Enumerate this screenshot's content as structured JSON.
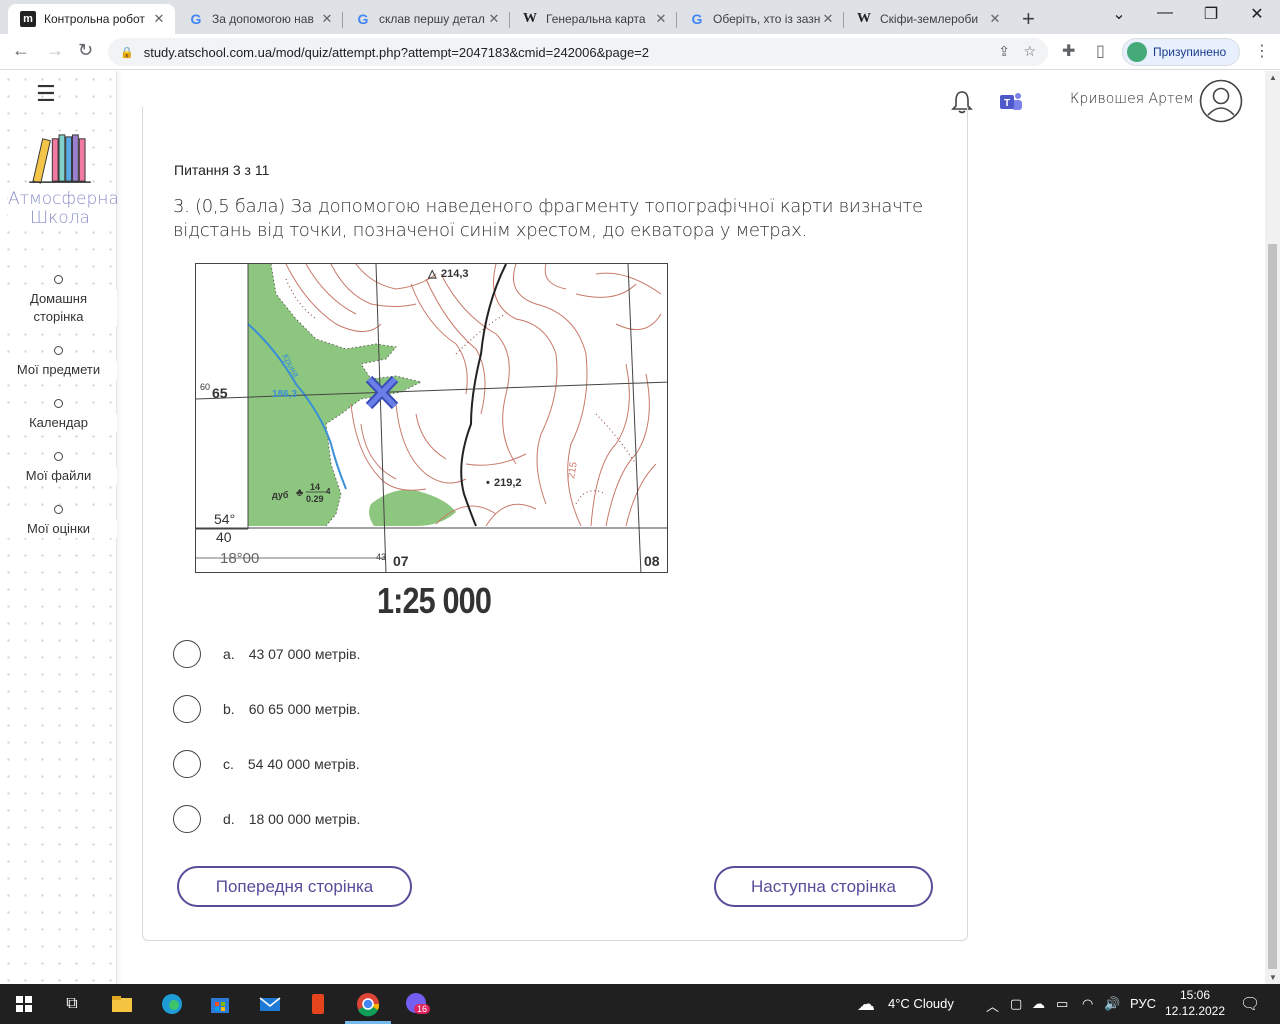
{
  "browser": {
    "tabs": [
      {
        "title": "Контрольна робот",
        "icon": "m",
        "active": true
      },
      {
        "title": "За допомогою нав",
        "icon": "G",
        "active": false
      },
      {
        "title": "склав першу детал",
        "icon": "G",
        "active": false
      },
      {
        "title": "Генеральна карта",
        "icon": "W",
        "active": false
      },
      {
        "title": "Оберіть, хто із зазн",
        "icon": "G",
        "active": false
      },
      {
        "title": "Скіфи-землероби",
        "icon": "W",
        "active": false
      }
    ],
    "url": "study.atschool.com.ua/mod/quiz/attempt.php?attempt=2047183&cmid=242006&page=2",
    "profile_label": "Призупинено"
  },
  "sidebar": {
    "logo_line1": "Атмосферна",
    "logo_line2": "Школа",
    "items": [
      {
        "label": "Домашня сторінка"
      },
      {
        "label": "Мої предмети"
      },
      {
        "label": "Календар"
      },
      {
        "label": "Мої файли"
      },
      {
        "label": "Мої оцінки"
      }
    ]
  },
  "header": {
    "user_name": "Кривошея Артем"
  },
  "question": {
    "number_label": "Питання 3 з 11",
    "text": "3.  (0,5 бала) За допомогою наведеного фрагменту топографічної карти визначте відстань від точки, позначеної синім хрестом, до екватора у метрах.",
    "map": {
      "labels": {
        "peak_top": "214,3",
        "row_65_prefix": "60",
        "row_65": "65",
        "height_186": "186,3",
        "river": "Крина",
        "point_219": "219,2",
        "contour_215": "215",
        "tree": "дуб",
        "tree_num1": "14",
        "tree_num2": "0.29",
        "tree_num3": "4",
        "lat_deg": "54°",
        "lat_min": "40",
        "lon_deg": "18°00",
        "col_07_prefix": "43",
        "col_07": "07",
        "col_08": "08"
      }
    },
    "scale": "1:25 000",
    "options": [
      {
        "letter": "a.",
        "text": "43 07 000 метрів."
      },
      {
        "letter": "b.",
        "text": "60 65 000 метрів."
      },
      {
        "letter": "c.",
        "text": "54 40 000 метрів."
      },
      {
        "letter": "d.",
        "text": "18 00 000 метрів."
      }
    ],
    "prev_button": "Попередня сторінка",
    "next_button": "Наступна сторінка"
  },
  "taskbar": {
    "weather": "4°C  Cloudy",
    "lang": "РУС",
    "time": "15:06",
    "date": "12.12.2022",
    "viber_badge": "16"
  }
}
